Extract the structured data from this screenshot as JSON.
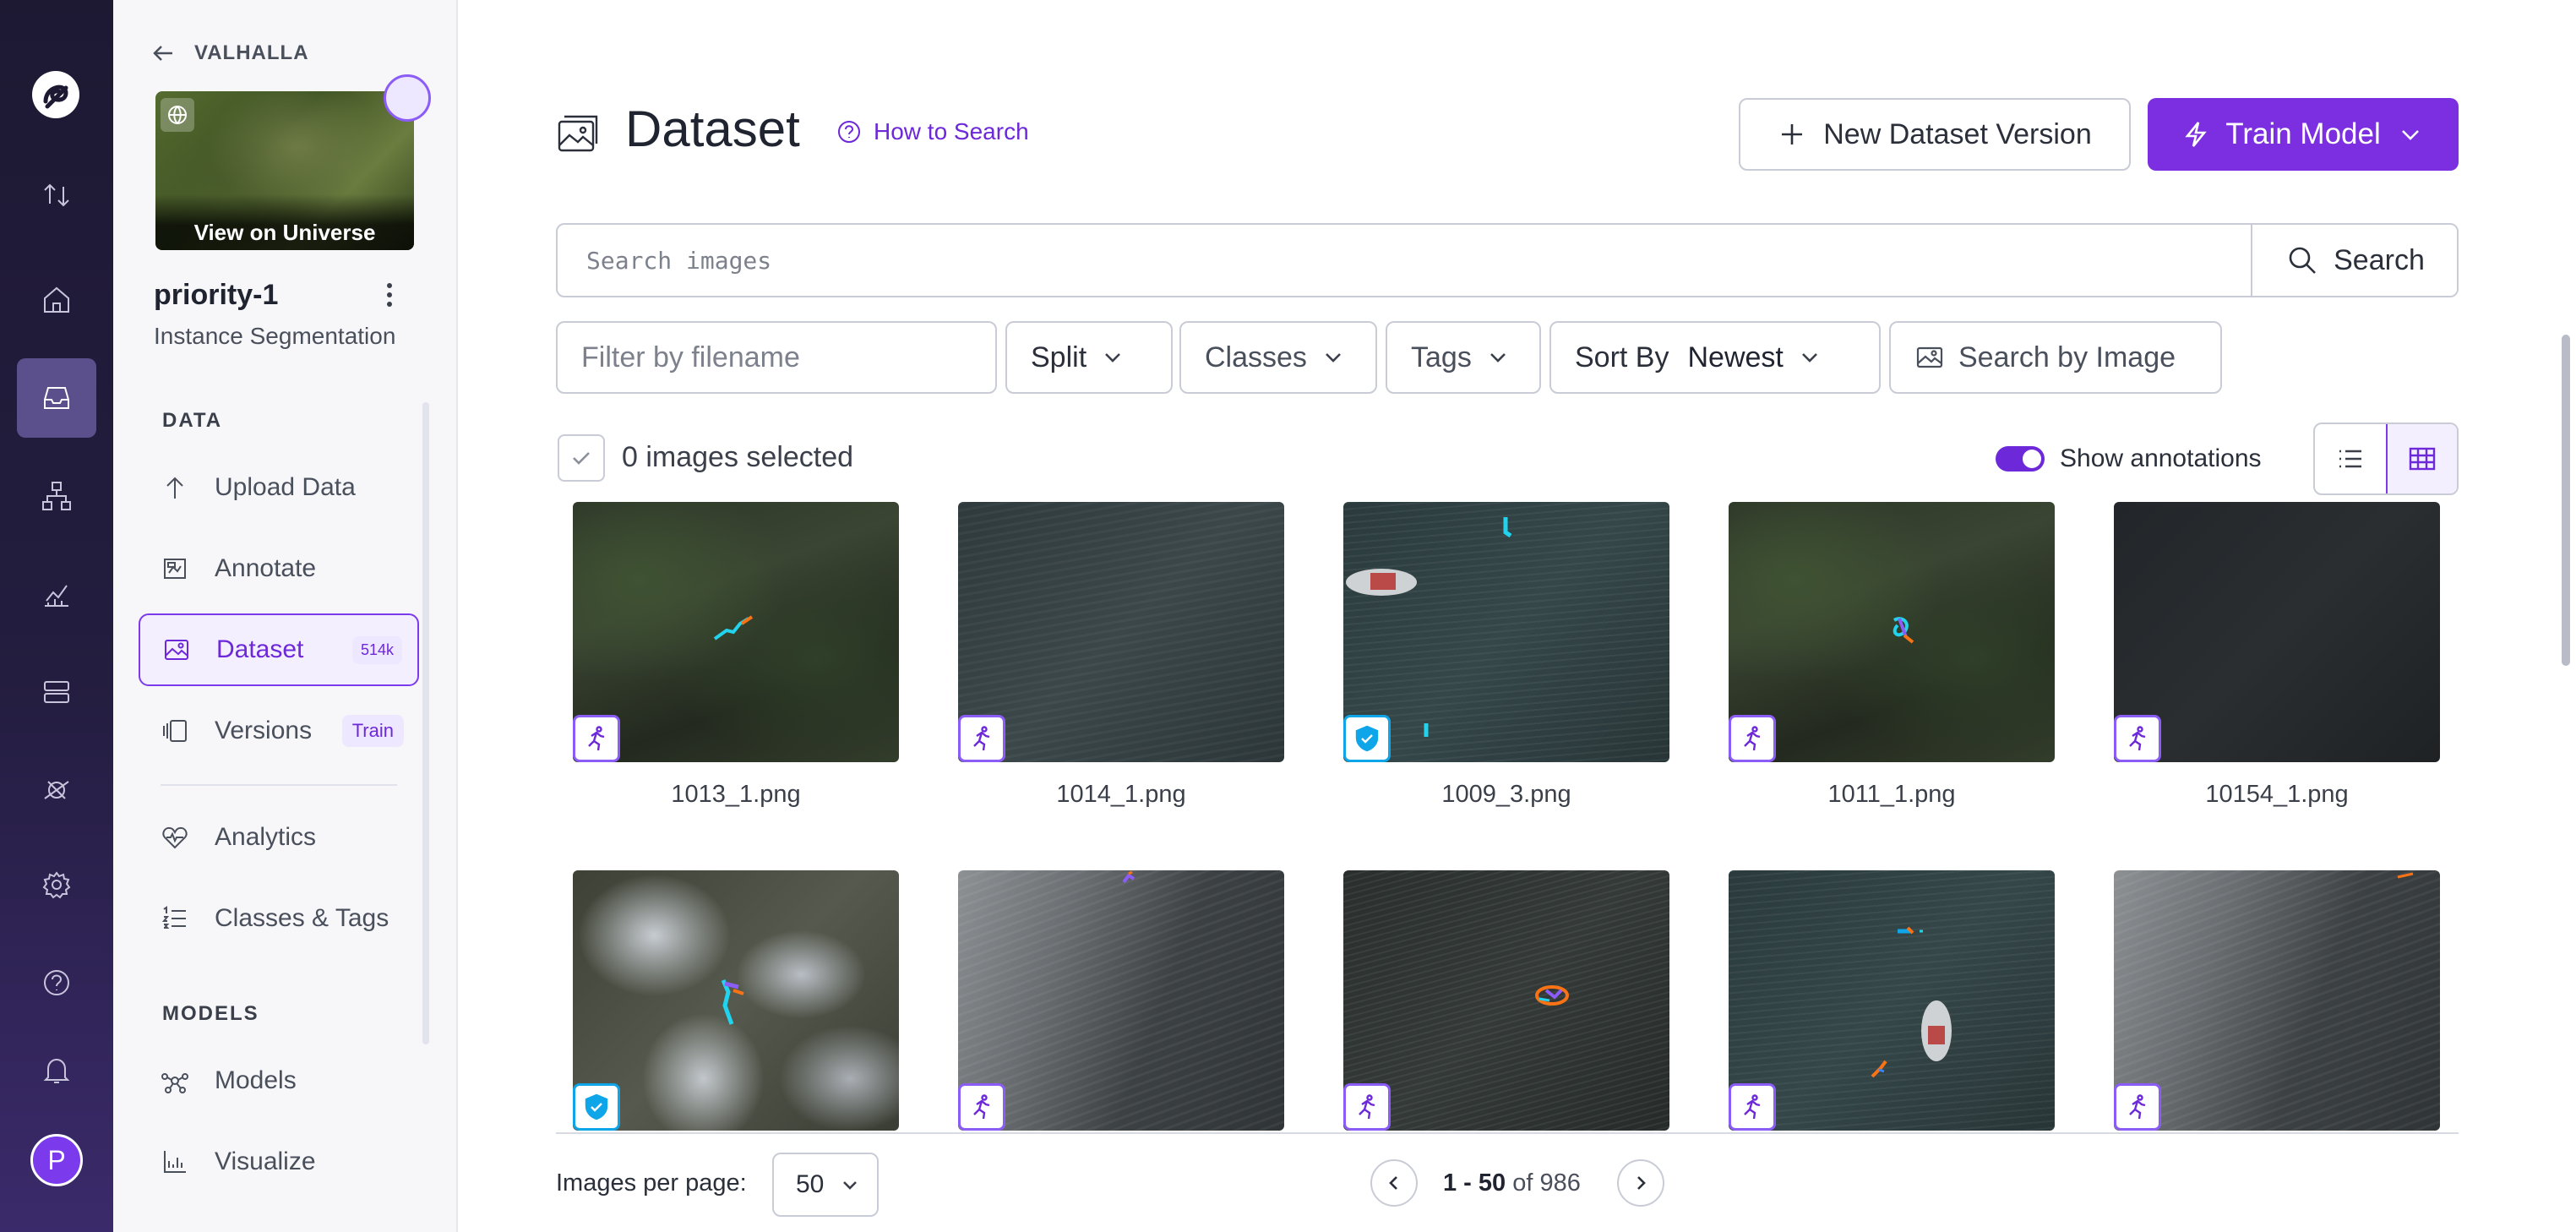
{
  "sidebar": {
    "back_label": "VALHALLA",
    "universe_label": "View on Universe",
    "project_name": "priority-1",
    "project_type": "Instance Segmentation",
    "sections": {
      "data": "DATA",
      "models": "MODELS"
    },
    "items": [
      {
        "label": "Upload Data",
        "icon": "upload-icon"
      },
      {
        "label": "Annotate",
        "icon": "annotate-icon"
      },
      {
        "label": "Dataset",
        "icon": "image-icon",
        "badge": "514k",
        "active": true
      },
      {
        "label": "Versions",
        "icon": "versions-icon",
        "badge": "Train"
      },
      {
        "label": "Analytics",
        "icon": "heart-pulse-icon"
      },
      {
        "label": "Classes & Tags",
        "icon": "list-icon"
      },
      {
        "label": "Models",
        "icon": "model-graph-icon"
      },
      {
        "label": "Visualize",
        "icon": "chart-icon"
      }
    ]
  },
  "rail": {
    "avatar_letter": "P",
    "icons": [
      "logo-icon",
      "swap-icon",
      "home-icon",
      "inbox-icon",
      "workflow-icon",
      "insights-icon",
      "deploy-icon",
      "satellite-icon",
      "settings-icon",
      "help-icon",
      "bell-icon"
    ]
  },
  "header": {
    "title": "Dataset",
    "how_to_search": "How to Search",
    "new_version_label": "New Dataset Version",
    "train_label": "Train Model"
  },
  "search": {
    "placeholder": "Search images",
    "button_label": "Search"
  },
  "filters": {
    "filename_placeholder": "Filter by filename",
    "split_label": "Split",
    "classes_label": "Classes",
    "tags_label": "Tags",
    "sort_label": "Sort By",
    "sort_value": "Newest",
    "search_by_image_label": "Search by Image"
  },
  "selection": {
    "count_label": "0 images selected",
    "show_annotations_label": "Show annotations",
    "show_annotations": true
  },
  "images": [
    {
      "name": "1013_1.png",
      "split": "train"
    },
    {
      "name": "1014_1.png",
      "split": "train"
    },
    {
      "name": "1009_3.png",
      "split": "valid"
    },
    {
      "name": "1011_1.png",
      "split": "train"
    },
    {
      "name": "10154_1.png",
      "split": "train"
    },
    {
      "name": "",
      "split": "valid"
    },
    {
      "name": "",
      "split": "train"
    },
    {
      "name": "",
      "split": "train"
    },
    {
      "name": "",
      "split": "train"
    },
    {
      "name": "",
      "split": "train"
    }
  ],
  "pagination": {
    "per_page_label": "Images per page:",
    "per_page_value": "50",
    "range": "1 - 50",
    "of_label": "of",
    "total": "986"
  },
  "colors": {
    "accent": "#7c2fe0",
    "train_badge": "#8b5cf6",
    "valid_badge": "#0ea5e9",
    "rail_bg": "#1d1933"
  }
}
